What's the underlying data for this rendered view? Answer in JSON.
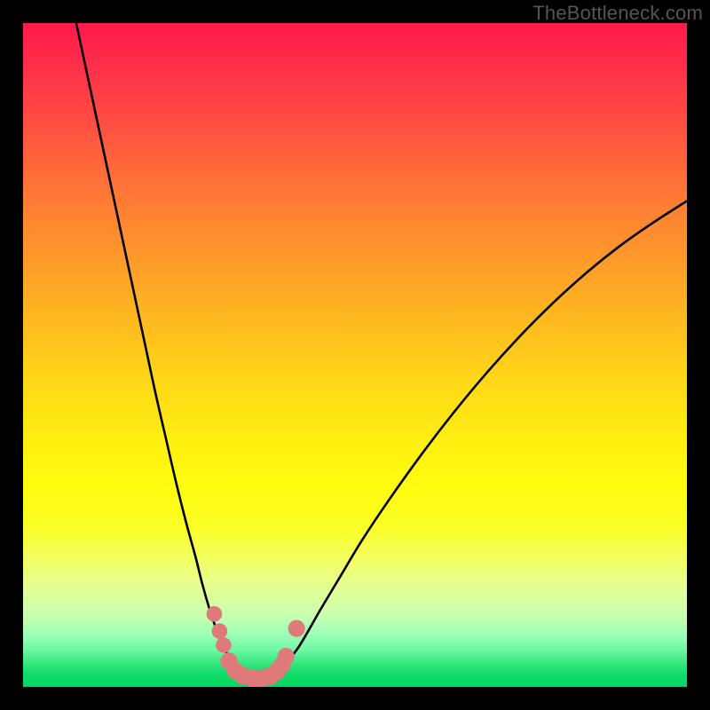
{
  "watermark": "TheBottleneck.com",
  "chart_data": {
    "type": "line",
    "title": "",
    "xlabel": "",
    "ylabel": "",
    "xlim": [
      0,
      100
    ],
    "ylim": [
      0,
      100
    ],
    "curve_left": {
      "x": [
        8.0,
        9.5,
        11.0,
        12.5,
        14.0,
        15.5,
        17.0,
        18.5,
        20.0,
        21.5,
        23.0,
        24.5,
        26.0,
        27.0,
        28.0,
        29.0,
        30.0,
        31.0,
        32.0,
        33.0,
        34.0
      ],
      "y": [
        100,
        93,
        86,
        79,
        72,
        65,
        58,
        51,
        44,
        37.5,
        31,
        25,
        19.5,
        15.5,
        12,
        9,
        6.5,
        4.5,
        3,
        2,
        1.5
      ]
    },
    "curve_right": {
      "x": [
        38,
        39,
        40,
        41.5,
        43,
        45,
        48,
        51,
        55,
        60,
        65,
        70,
        75,
        80,
        85,
        90,
        95,
        100
      ],
      "y": [
        1.5,
        2.5,
        4,
        6,
        8.5,
        12,
        17,
        22,
        28,
        35,
        41.5,
        47.5,
        53,
        58,
        62.5,
        66.5,
        70,
        73.2
      ]
    },
    "valley_dots": [
      {
        "x": 28.8,
        "y": 11.0,
        "r": 1.2
      },
      {
        "x": 29.6,
        "y": 8.4,
        "r": 1.2
      },
      {
        "x": 30.2,
        "y": 6.3,
        "r": 1.2
      },
      {
        "x": 31.0,
        "y": 3.9,
        "r": 1.4
      },
      {
        "x": 32.0,
        "y": 2.4,
        "r": 1.4
      },
      {
        "x": 33.2,
        "y": 1.6,
        "r": 1.5
      },
      {
        "x": 34.6,
        "y": 1.3,
        "r": 1.5
      },
      {
        "x": 36.0,
        "y": 1.3,
        "r": 1.5
      },
      {
        "x": 37.2,
        "y": 1.6,
        "r": 1.5
      },
      {
        "x": 38.2,
        "y": 2.3,
        "r": 1.5
      },
      {
        "x": 39.0,
        "y": 3.3,
        "r": 1.4
      },
      {
        "x": 39.6,
        "y": 4.6,
        "r": 1.4
      },
      {
        "x": 41.2,
        "y": 8.8,
        "r": 1.4
      }
    ],
    "colors": {
      "curve": "#000000",
      "dots": "#e07a7a"
    }
  }
}
